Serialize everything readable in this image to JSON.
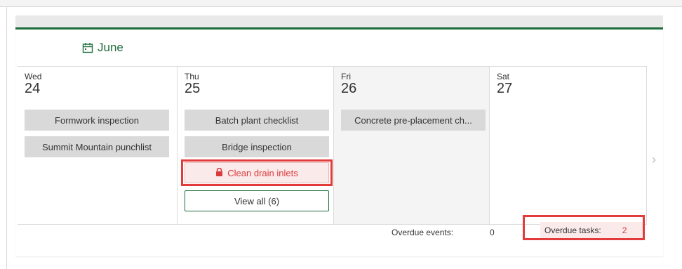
{
  "calendar": {
    "month_label": "June",
    "days": [
      {
        "dow": "Wed",
        "num": "24",
        "events": [
          {
            "title": "Formwork inspection"
          },
          {
            "title": "Summit Mountain punchlist"
          }
        ]
      },
      {
        "dow": "Thu",
        "num": "25",
        "events": [
          {
            "title": "Batch plant checklist"
          },
          {
            "title": "Bridge inspection"
          },
          {
            "title": "Clean drain inlets",
            "locked": true
          }
        ],
        "view_all": "View all (6)"
      },
      {
        "dow": "Fri",
        "num": "26",
        "events": [
          {
            "title": "Concrete pre-placement ch..."
          }
        ]
      },
      {
        "dow": "Sat",
        "num": "27",
        "events": []
      }
    ],
    "footer": {
      "overdue_events_label": "Overdue events:",
      "overdue_events_value": "0",
      "overdue_tasks_label": "Overdue tasks:",
      "overdue_tasks_value": "2"
    },
    "colors": {
      "accent": "#1d6b3c",
      "alert": "#d93a3a",
      "highlight": "#e33b3b"
    }
  }
}
